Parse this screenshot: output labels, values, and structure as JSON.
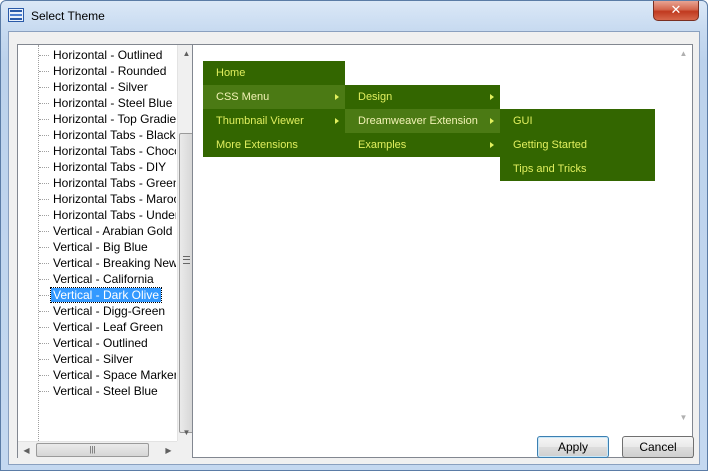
{
  "window": {
    "title": "Select Theme",
    "close_glyph": "✕"
  },
  "tree": {
    "items": [
      "Horizontal - Outlined",
      "Horizontal - Rounded",
      "Horizontal - Silver",
      "Horizontal - Steel Blue",
      "Horizontal - Top Gradient",
      "Horizontal Tabs - Black Ta",
      "Horizontal Tabs - Chocolat",
      "Horizontal Tabs - DIY",
      "Horizontal Tabs - Green Po",
      "Horizontal Tabs - Maroon",
      "Horizontal Tabs - Underse",
      "Vertical - Arabian Gold",
      "Vertical - Big Blue",
      "Vertical - Breaking News",
      "Vertical - California",
      "Vertical - Dark Olive",
      "Vertical - Digg-Green",
      "Vertical - Leaf Green",
      "Vertical - Outlined",
      "Vertical - Silver",
      "Vertical - Space Marker",
      "Vertical - Steel Blue"
    ],
    "selected_index": 15
  },
  "preview": {
    "level1": [
      {
        "label": "Home",
        "has_sub": false,
        "active": false
      },
      {
        "label": "CSS Menu",
        "has_sub": true,
        "active": true
      },
      {
        "label": "Thumbnail Viewer",
        "has_sub": true,
        "active": false
      },
      {
        "label": "More Extensions",
        "has_sub": false,
        "active": false
      }
    ],
    "level2": [
      {
        "label": "Design",
        "has_sub": true,
        "active": false
      },
      {
        "label": "Dreamweaver Extension",
        "has_sub": true,
        "active": true
      },
      {
        "label": "Examples",
        "has_sub": true,
        "active": false
      }
    ],
    "level3": [
      {
        "label": "GUI",
        "has_sub": false,
        "active": false
      },
      {
        "label": "Getting Started",
        "has_sub": false,
        "active": false
      },
      {
        "label": "Tips and Tricks",
        "has_sub": false,
        "active": false
      }
    ],
    "colors": {
      "menu_bg": "#336600",
      "menu_active_bg": "#4b7a14",
      "menu_text": "#e1ef5e"
    }
  },
  "buttons": {
    "apply": "Apply",
    "cancel": "Cancel"
  }
}
